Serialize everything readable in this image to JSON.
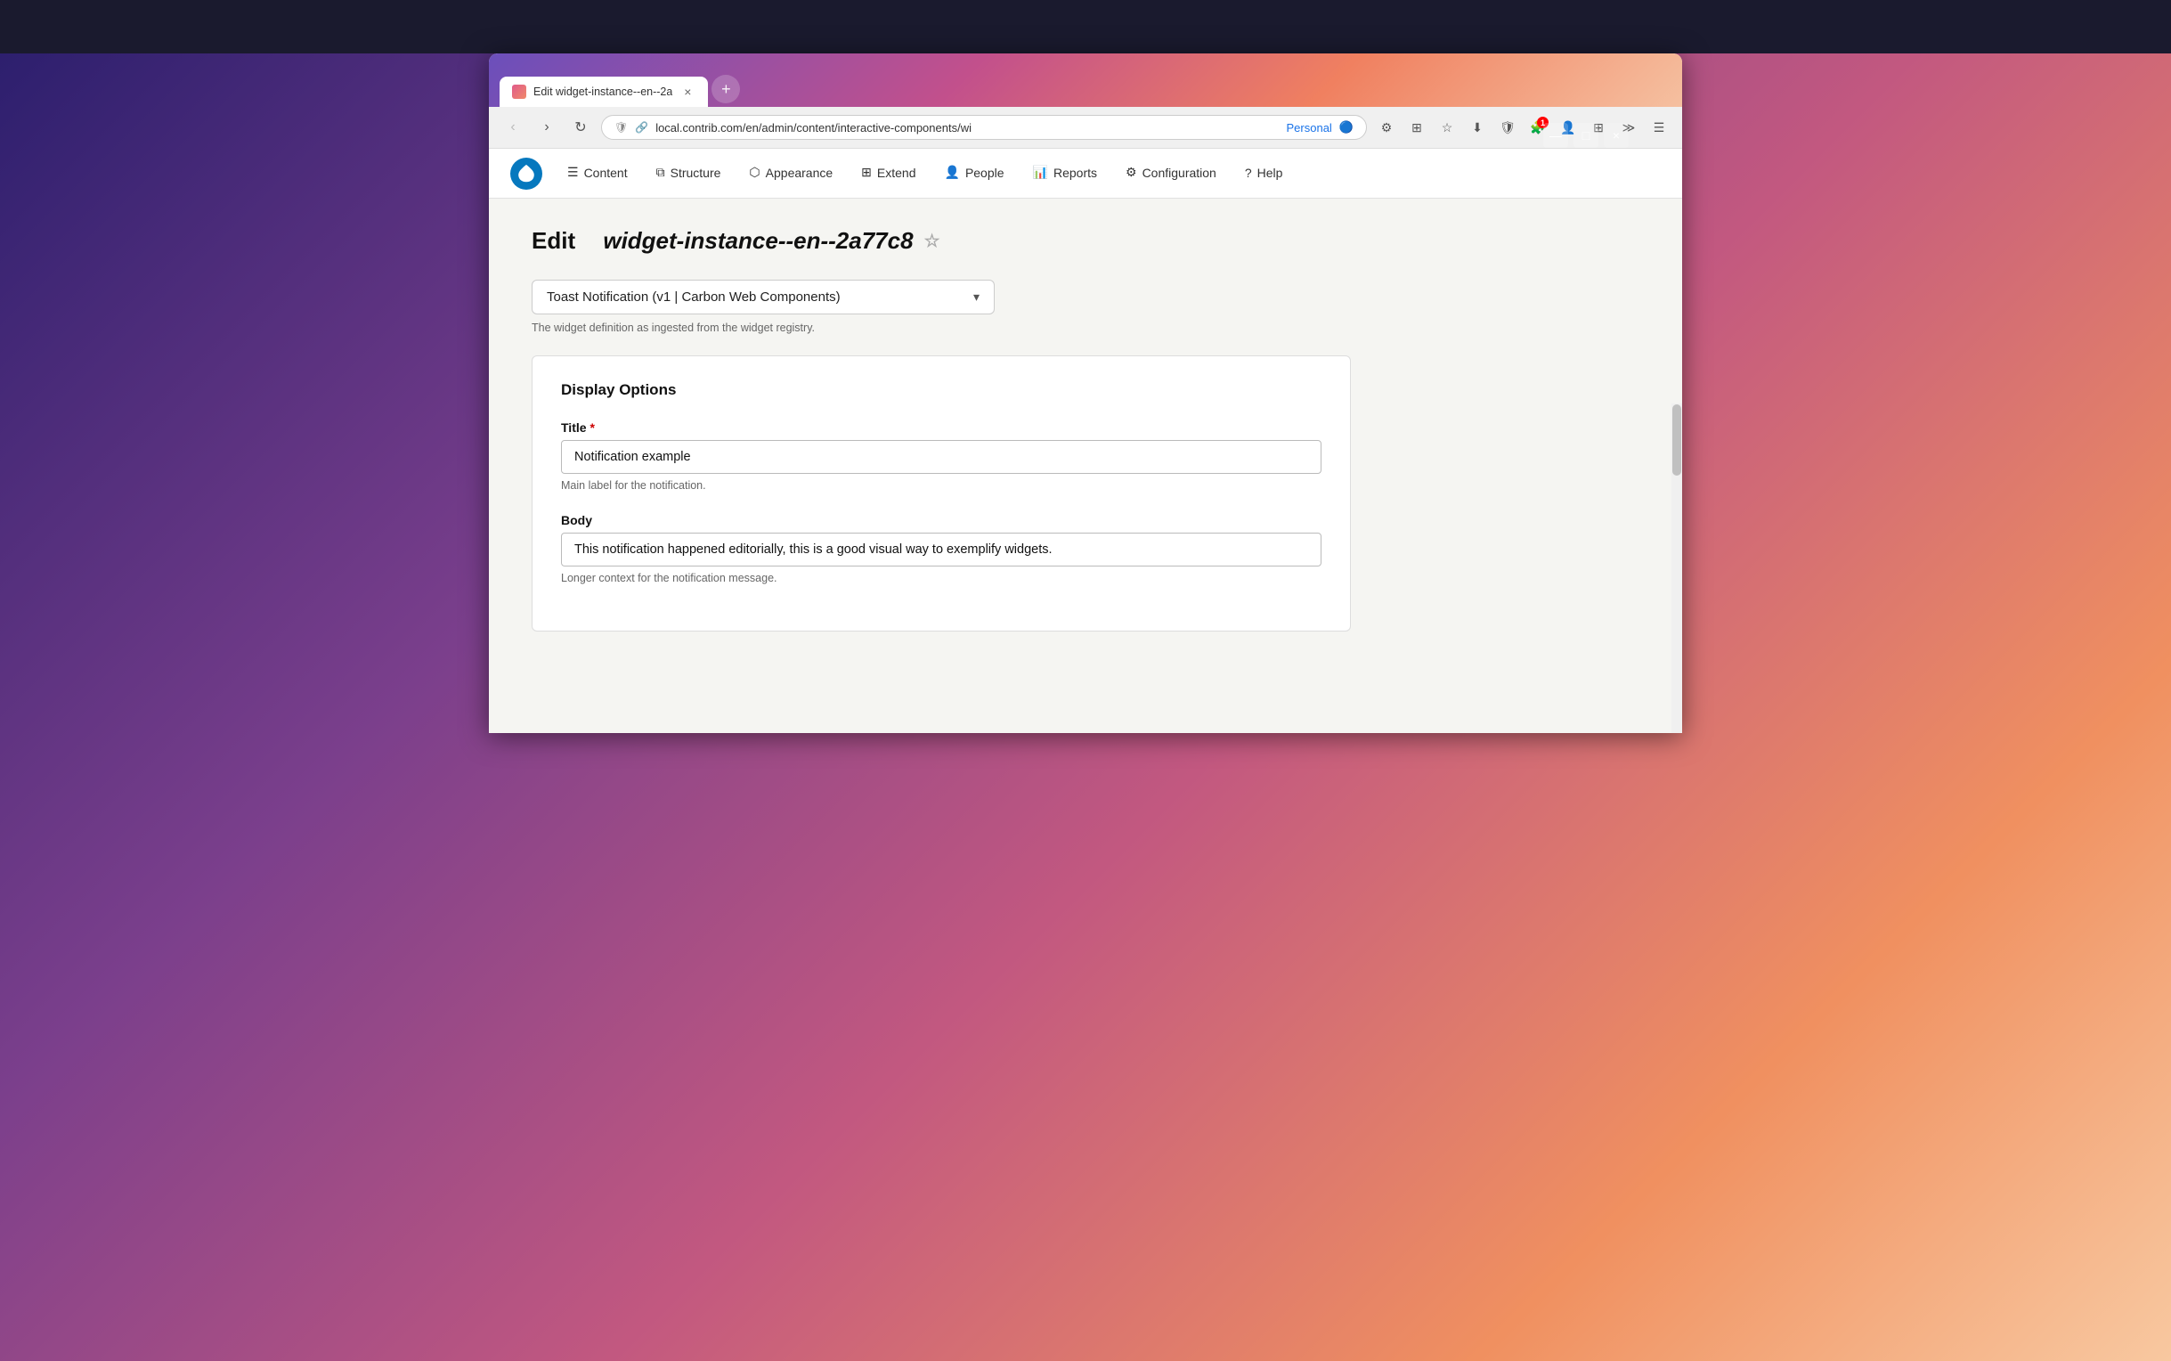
{
  "browser": {
    "tab_label": "Edit widget-instance--en--2a",
    "tab_close": "×",
    "new_tab": "+",
    "nav": {
      "back": "‹",
      "forward": "›",
      "refresh": "↻",
      "address": "local.contrib.com/en/admin/content/interactive-components/wi",
      "personal": "Personal",
      "minimize": "—",
      "maximize": "□",
      "close": "×"
    }
  },
  "drupal_nav": {
    "logo_icon": "◉",
    "items": [
      {
        "label": "Content",
        "icon": "☰"
      },
      {
        "label": "Structure",
        "icon": "⧉"
      },
      {
        "label": "Appearance",
        "icon": "⬡"
      },
      {
        "label": "Extend",
        "icon": "⊞"
      },
      {
        "label": "People",
        "icon": "👤"
      },
      {
        "label": "Reports",
        "icon": "📊"
      },
      {
        "label": "Configuration",
        "icon": "⚙"
      },
      {
        "label": "Help",
        "icon": "?"
      }
    ]
  },
  "page": {
    "title_prefix": "Edit",
    "title_slug": "widget-instance--en--2a77c8",
    "star_icon": "☆",
    "widget_selector": {
      "label": "Toast Notification (v1 | Carbon Web Components)",
      "chevron": "▾"
    },
    "widget_hint": "The widget definition as ingested from the widget registry.",
    "form": {
      "section_title": "Display Options",
      "title_label": "Title",
      "title_required": "*",
      "title_value": "Notification example",
      "title_hint": "Main label for the notification.",
      "body_label": "Body",
      "body_value": "This notification happened editorially, this is a good visual way to exemplify widgets.",
      "body_hint": "Longer context for the notification message."
    }
  }
}
